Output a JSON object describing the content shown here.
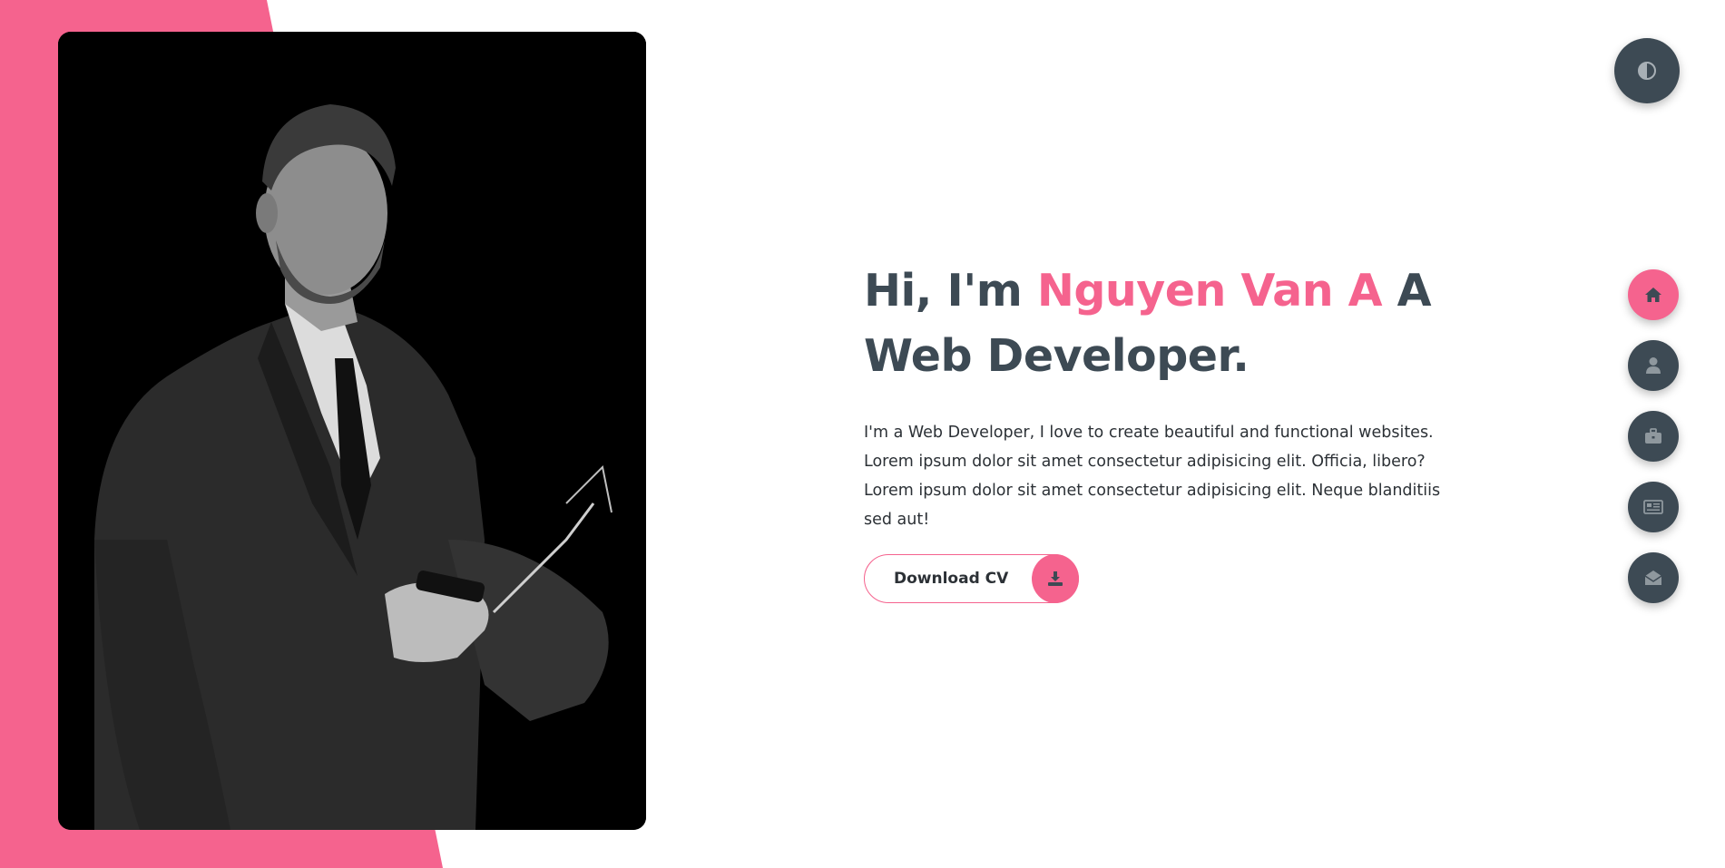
{
  "colors": {
    "accent": "#f5638e",
    "dark": "#3d4a54",
    "text": "#2c3136",
    "background": "#ffffff"
  },
  "hero": {
    "greeting": "Hi, I'm ",
    "name": "Nguyen Van A",
    "role_line1": " A",
    "role_line2": "Web Developer.",
    "bio": "I'm a Web Developer, I love to create beautiful and functional websites. Lorem ipsum dolor sit amet consectetur adipisicing elit. Officia, libero? Lorem ipsum dolor sit amet consectetur adipisicing elit. Neque blanditiis sed aut!",
    "cv_button_label": "Download CV",
    "cv_button_icon": "download-icon"
  },
  "portrait": {
    "icon": "person-portrait"
  },
  "theme_toggle": {
    "icon": "contrast-icon"
  },
  "nav": {
    "items": [
      {
        "name": "home",
        "icon": "home-icon",
        "active": true
      },
      {
        "name": "about",
        "icon": "user-icon",
        "active": false
      },
      {
        "name": "portfolio",
        "icon": "briefcase-icon",
        "active": false
      },
      {
        "name": "blogs",
        "icon": "newspaper-icon",
        "active": false
      },
      {
        "name": "contact",
        "icon": "envelope-open-icon",
        "active": false
      }
    ]
  }
}
